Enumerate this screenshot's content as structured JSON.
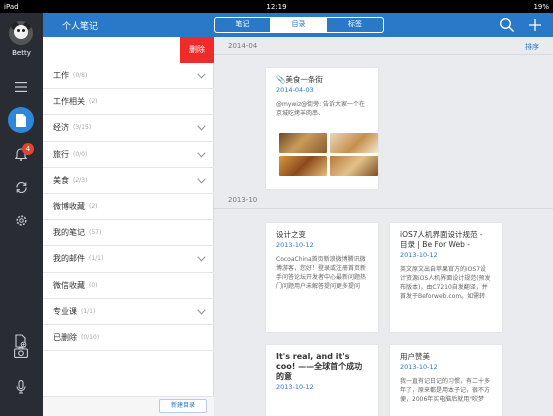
{
  "status_bar": {
    "device": "iPad",
    "time": "12:19",
    "battery": "19%"
  },
  "user": {
    "name": "Betty"
  },
  "rail": {
    "notification_count": "4"
  },
  "header": {
    "title": "个人笔记",
    "tabs": [
      {
        "label": "笔记",
        "active": false
      },
      {
        "label": "目录",
        "active": true
      },
      {
        "label": "标签",
        "active": false
      }
    ]
  },
  "panel": {
    "delete_label": "删除",
    "new_folder_label": "新建目录",
    "items": [
      {
        "label": "工作",
        "count": "(0/8)",
        "expandable": true
      },
      {
        "label": "工作相关",
        "count": "(2)",
        "expandable": false
      },
      {
        "label": "经济",
        "count": "(3/15)",
        "expandable": true
      },
      {
        "label": "旅行",
        "count": "(0/0)",
        "expandable": true
      },
      {
        "label": "美食",
        "count": "(2/3)",
        "expandable": true
      },
      {
        "label": "微博收藏",
        "count": "(2)",
        "expandable": false
      },
      {
        "label": "我的笔记",
        "count": "(57)",
        "expandable": false
      },
      {
        "label": "我的邮件",
        "count": "(1/1)",
        "expandable": true
      },
      {
        "label": "微信收藏",
        "count": "(0)",
        "expandable": false
      },
      {
        "label": "专业课",
        "count": "(1/1)",
        "expandable": true
      },
      {
        "label": "已删除",
        "count": "(0/10)",
        "expandable": false
      }
    ]
  },
  "main": {
    "sort_label": "排序",
    "sections": [
      {
        "date": "2014-04",
        "notes": [
          {
            "title": "美食一条街",
            "date": "2014-04-03",
            "snippet": "@mywiz@街旁: 告诉大家一个在京城吃烤羊肉串、",
            "has_images": true
          }
        ]
      },
      {
        "date": "2013-10",
        "notes": [
          {
            "title": "设计之变",
            "date": "2013-10-12",
            "snippet": "CocoaChina首页新浪微博腾讯微博游客，您好！登录或注册首页新手问答论坛开发者中心最新问题热门问题用户未解答提问更多提问"
          },
          {
            "title": "iOS7人机界面设计规范 - 目录 | Be For Web -",
            "date": "2013-10-12",
            "snippet": "英文原文出自苹果官方的iOS7设计资源iOS人机界面设计规范(预发布版本)，由C7210自发翻译，并首发于Beforweb.com。如需转"
          },
          {
            "title": "It's real, and it's coo! ——全球首个成功的意",
            "date": "2013-10-12",
            "snippet": ""
          },
          {
            "title": "用户赞美",
            "date": "2013-10-12",
            "snippet": "我一直有记日记的习惯，有二十多年了，原来都是用本子记，很不方便，2006年买电脑后就用\"吹梦"
          }
        ]
      }
    ]
  },
  "colors": {
    "header_blue": "#2a78c8",
    "delete_red": "#ef2a2a",
    "rail_dark": "#2a2c33",
    "date_blue": "#2a78c8"
  }
}
